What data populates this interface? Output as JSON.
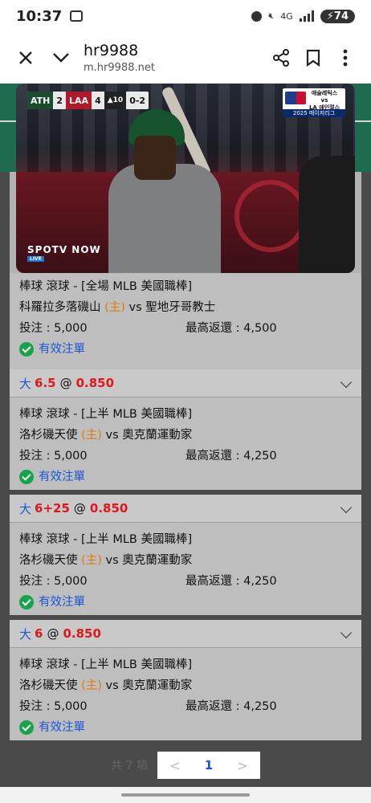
{
  "status_bar": {
    "time": "10:37",
    "network": "4G",
    "battery": "74"
  },
  "browser": {
    "page_title": "hr9988",
    "url": "m.hr9988.net",
    "icons": [
      "close-icon",
      "chevron-down-icon",
      "share-icon",
      "bookmark-icon",
      "more-vert-icon"
    ]
  },
  "video": {
    "scorebug": {
      "team1": "ATH",
      "score1": "2",
      "team2": "LAA",
      "score2": "4",
      "inning": "▲10",
      "count": "0-2"
    },
    "broadcaster": "SPOTV NOW",
    "live_badge": "LIVE",
    "logo_line1": "애슬레틱스",
    "logo_line2": "vs",
    "logo_line3": "LA 에인절스",
    "logo_bottom": "2025 메이저리그"
  },
  "labels": {
    "stake_label": "投注 : ",
    "max_return_label": "最高返還 : ",
    "home_marker": "(主)",
    "vs": "vs",
    "valid": "有效注單"
  },
  "bets": [
    {
      "header": null,
      "market": "棒球 滾球 - [全場 MLB 美國職棒]",
      "home": "科羅拉多落磯山",
      "away": "聖地牙哥教士",
      "stake": "5,000",
      "max_return": "4,500"
    },
    {
      "header": {
        "side": "大",
        "line": "6.5",
        "at": "@",
        "odds": "0.850"
      },
      "market": "棒球 滾球 - [上半 MLB 美國職棒]",
      "home": "洛杉磯天使",
      "away": "奧克蘭運動家",
      "stake": "5,000",
      "max_return": "4,250"
    },
    {
      "header": {
        "side": "大",
        "line": "6+25",
        "at": "@",
        "odds": "0.850"
      },
      "market": "棒球 滾球 - [上半 MLB 美國職棒]",
      "home": "洛杉磯天使",
      "away": "奧克蘭運動家",
      "stake": "5,000",
      "max_return": "4,250"
    },
    {
      "header": {
        "side": "大",
        "line": "6",
        "at": "@",
        "odds": "0.850"
      },
      "market": "棒球 滾球 - [上半 MLB 美國職棒]",
      "home": "洛杉磯天使",
      "away": "奧克蘭運動家",
      "stake": "5,000",
      "max_return": "4,250"
    }
  ],
  "pagination": {
    "total": "共 7 項",
    "prev": "<",
    "page": "1",
    "next": ">"
  }
}
